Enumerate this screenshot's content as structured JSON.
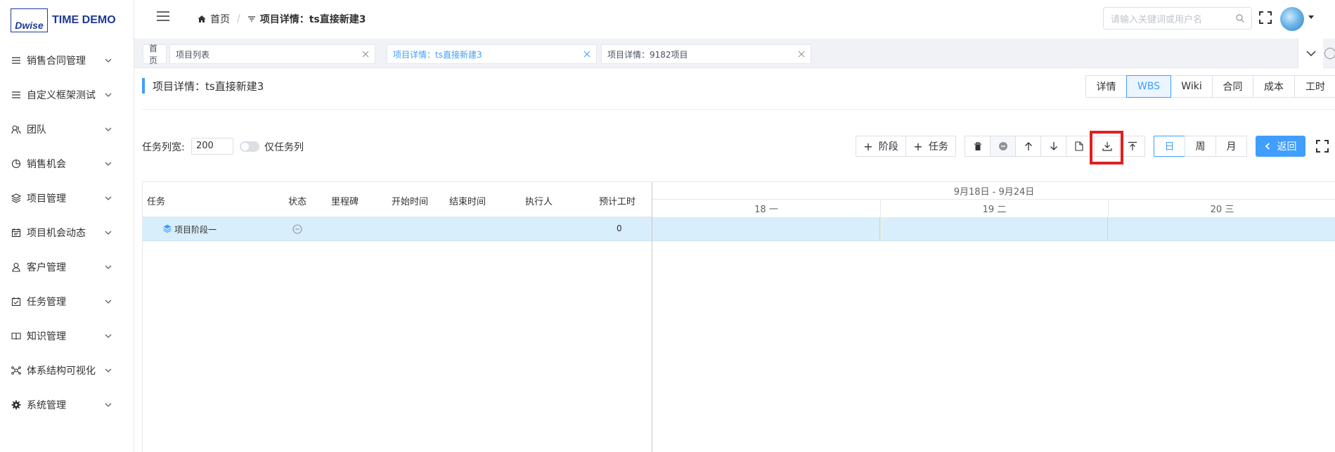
{
  "brand": {
    "logo_text": "Dwise",
    "app_name": "TIME DEMO"
  },
  "sidebar": {
    "items": [
      {
        "label": "销售合同管理",
        "icon": "list-icon"
      },
      {
        "label": "自定义框架测试",
        "icon": "list-icon"
      },
      {
        "label": "团队",
        "icon": "team-icon"
      },
      {
        "label": "销售机会",
        "icon": "pie-chart-icon"
      },
      {
        "label": "项目管理",
        "icon": "layers-icon"
      },
      {
        "label": "项目机会动态",
        "icon": "calendar-icon"
      },
      {
        "label": "客户管理",
        "icon": "user-icon"
      },
      {
        "label": "任务管理",
        "icon": "check-calendar-icon"
      },
      {
        "label": "知识管理",
        "icon": "book-icon"
      },
      {
        "label": "体系结构可视化",
        "icon": "network-icon"
      },
      {
        "label": "系统管理",
        "icon": "gear-icon"
      }
    ]
  },
  "header": {
    "breadcrumb_home": "首页",
    "breadcrumb_sep": "/",
    "breadcrumb_current": "项目详情：ts直接新建3",
    "search_placeholder": "请输入关键词或用户名"
  },
  "tabs": [
    {
      "label": "首页",
      "closable": false
    },
    {
      "label": "项目列表",
      "closable": true
    },
    {
      "label": "项目详情：ts直接新建3",
      "closable": true,
      "active": true
    },
    {
      "label": "项目详情：9182项目",
      "closable": true
    }
  ],
  "page": {
    "title": "项目详情：ts直接新建3",
    "view_tabs": [
      "详情",
      "WBS",
      "Wiki",
      "合同",
      "成本",
      "工时"
    ],
    "active_view": "WBS"
  },
  "toolbar": {
    "col_width_label": "任务列宽:",
    "col_width_value": "200",
    "only_task_label": "仅任务列",
    "add_stage": "阶段",
    "add_task": "任务",
    "scale_day": "日",
    "scale_week": "周",
    "scale_month": "月",
    "active_scale": "日",
    "back": "返回"
  },
  "grid": {
    "columns": [
      "任务",
      "状态",
      "里程碑",
      "开始时间",
      "结束时间",
      "执行人",
      "预计工时"
    ],
    "rows": [
      {
        "name": "项目阶段一",
        "status_icon": "minus-circle-icon",
        "milestone": "",
        "start": "",
        "end": "",
        "assignee": "",
        "hours": "0"
      }
    ]
  },
  "timeline": {
    "week_label": "9月18日 - 9月24日",
    "days": [
      "18 一",
      "19 二",
      "20 三"
    ]
  },
  "colors": {
    "accent": "#409eff",
    "row_highlight": "#d9eefb",
    "marker": "#e02020"
  }
}
